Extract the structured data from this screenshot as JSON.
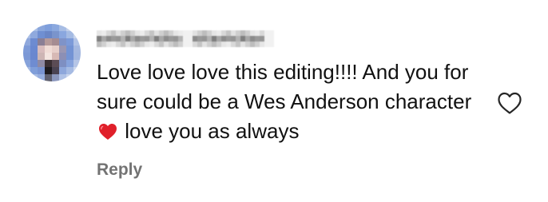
{
  "comment": {
    "username": "",
    "text_before_emoji": "Love love love this editing!!!! And you for sure could be a Wes Anderson character ",
    "emoji": "red-heart-emoji",
    "text_after_emoji": " love you as always",
    "reply_label": "Reply",
    "like_icon": "heart-outline-icon",
    "emoji_color": "#e0202a",
    "like_icon_color": "#262626"
  }
}
